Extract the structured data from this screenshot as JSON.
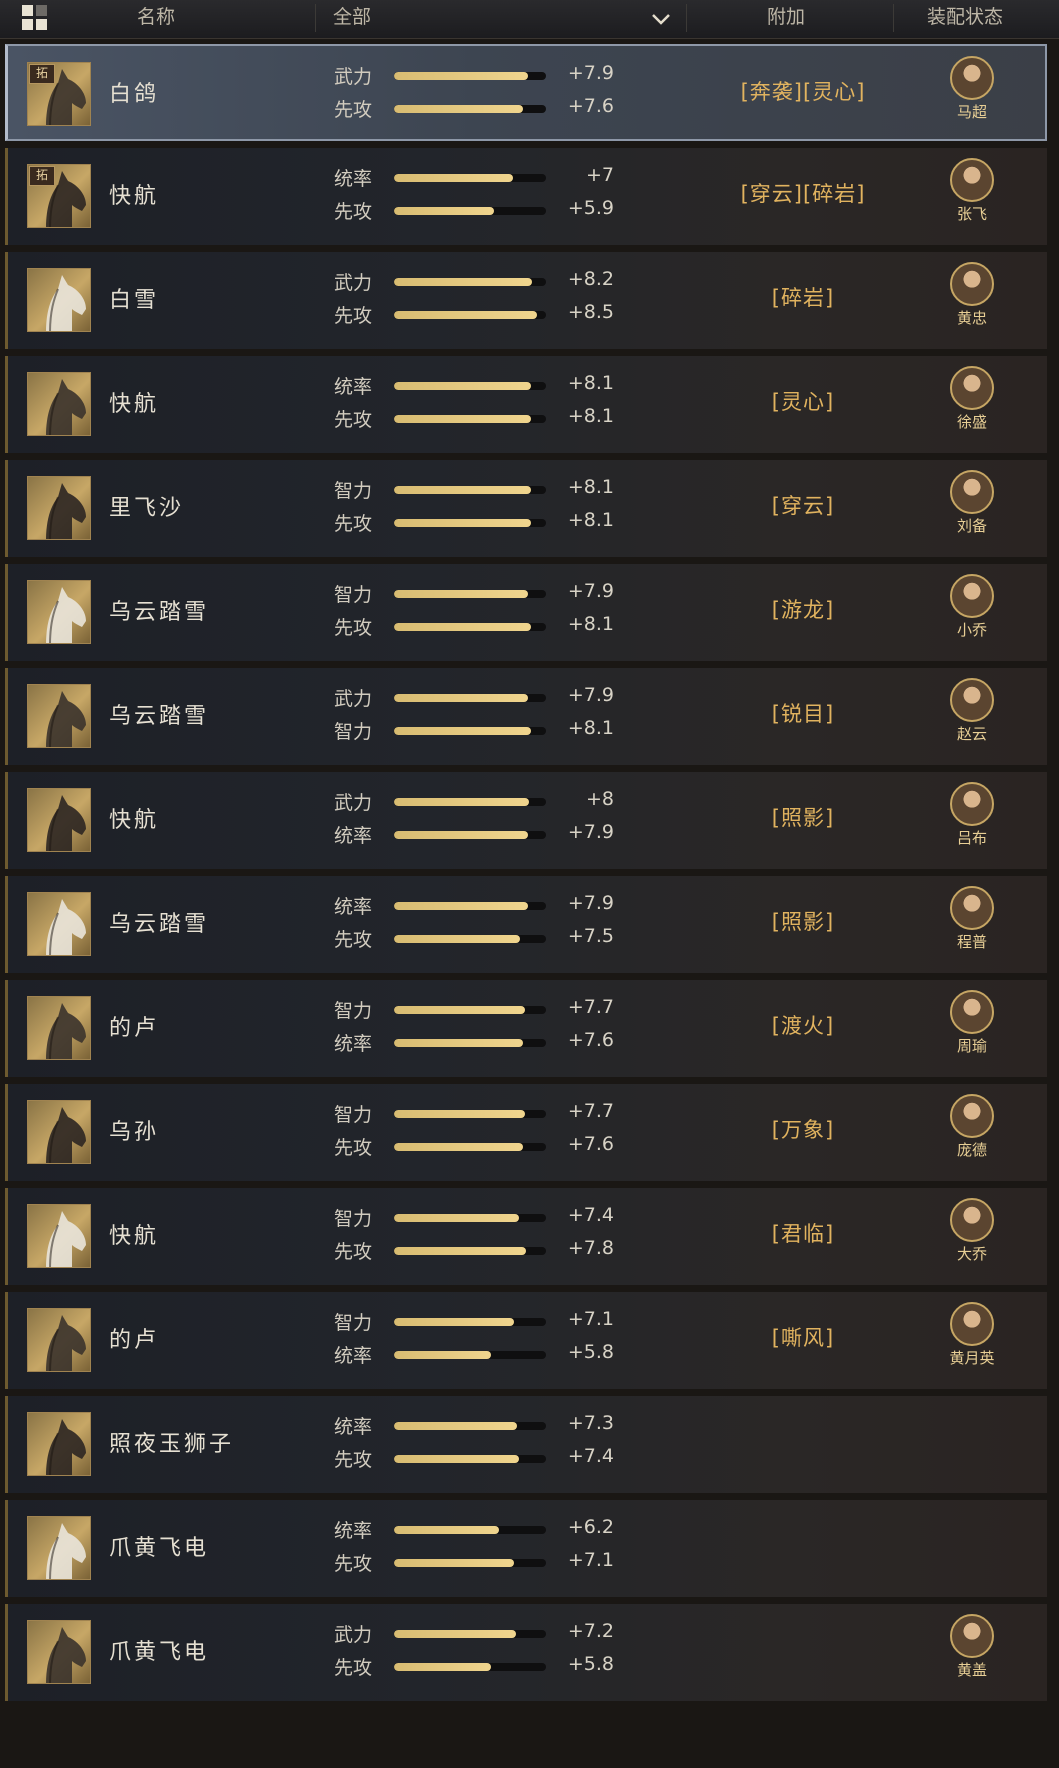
{
  "header": {
    "name_label": "名称",
    "filter_value": "全部",
    "extra_label": "附加",
    "equip_label": "装配状态"
  },
  "colors": {
    "accent_gold": "#e1b35f",
    "bar_fill": "#e8cc84",
    "selected_row": "#4a5464"
  },
  "rows": [
    {
      "tuo": "拓",
      "name": "白鸽",
      "s1": "武力",
      "p1": 0.88,
      "v1": "+7.9",
      "s2": "先攻",
      "p2": 0.85,
      "v2": "+7.6",
      "extra": "[奔袭][灵心]",
      "general": "马超",
      "selected": true
    },
    {
      "tuo": "拓",
      "name": "快航",
      "s1": "统率",
      "p1": 0.78,
      "v1": "+7",
      "s2": "先攻",
      "p2": 0.66,
      "v2": "+5.9",
      "extra": "[穿云][碎岩]",
      "general": "张飞",
      "selected": false
    },
    {
      "tuo": "",
      "name": "白雪",
      "s1": "武力",
      "p1": 0.91,
      "v1": "+8.2",
      "s2": "先攻",
      "p2": 0.94,
      "v2": "+8.5",
      "extra": "[碎岩]",
      "general": "黄忠",
      "selected": false
    },
    {
      "tuo": "",
      "name": "快航",
      "s1": "统率",
      "p1": 0.9,
      "v1": "+8.1",
      "s2": "先攻",
      "p2": 0.9,
      "v2": "+8.1",
      "extra": "[灵心]",
      "general": "徐盛",
      "selected": false
    },
    {
      "tuo": "",
      "name": "里飞沙",
      "s1": "智力",
      "p1": 0.9,
      "v1": "+8.1",
      "s2": "先攻",
      "p2": 0.9,
      "v2": "+8.1",
      "extra": "[穿云]",
      "general": "刘备",
      "selected": false
    },
    {
      "tuo": "",
      "name": "乌云踏雪",
      "s1": "智力",
      "p1": 0.88,
      "v1": "+7.9",
      "s2": "先攻",
      "p2": 0.9,
      "v2": "+8.1",
      "extra": "[游龙]",
      "general": "小乔",
      "selected": false
    },
    {
      "tuo": "",
      "name": "乌云踏雪",
      "s1": "武力",
      "p1": 0.88,
      "v1": "+7.9",
      "s2": "智力",
      "p2": 0.9,
      "v2": "+8.1",
      "extra": "[锐目]",
      "general": "赵云",
      "selected": false
    },
    {
      "tuo": "",
      "name": "快航",
      "s1": "武力",
      "p1": 0.89,
      "v1": "+8",
      "s2": "统率",
      "p2": 0.88,
      "v2": "+7.9",
      "extra": "[照影]",
      "general": "吕布",
      "selected": false
    },
    {
      "tuo": "",
      "name": "乌云踏雪",
      "s1": "统率",
      "p1": 0.88,
      "v1": "+7.9",
      "s2": "先攻",
      "p2": 0.83,
      "v2": "+7.5",
      "extra": "[照影]",
      "general": "程普",
      "selected": false
    },
    {
      "tuo": "",
      "name": "的卢",
      "s1": "智力",
      "p1": 0.86,
      "v1": "+7.7",
      "s2": "统率",
      "p2": 0.85,
      "v2": "+7.6",
      "extra": "[渡火]",
      "general": "周瑜",
      "selected": false
    },
    {
      "tuo": "",
      "name": "乌孙",
      "s1": "智力",
      "p1": 0.86,
      "v1": "+7.7",
      "s2": "先攻",
      "p2": 0.85,
      "v2": "+7.6",
      "extra": "[万象]",
      "general": "庞德",
      "selected": false
    },
    {
      "tuo": "",
      "name": "快航",
      "s1": "智力",
      "p1": 0.82,
      "v1": "+7.4",
      "s2": "先攻",
      "p2": 0.87,
      "v2": "+7.8",
      "extra": "[君临]",
      "general": "大乔",
      "selected": false
    },
    {
      "tuo": "",
      "name": "的卢",
      "s1": "智力",
      "p1": 0.79,
      "v1": "+7.1",
      "s2": "统率",
      "p2": 0.64,
      "v2": "+5.8",
      "extra": "[嘶风]",
      "general": "黄月英",
      "selected": false
    },
    {
      "tuo": "",
      "name": "照夜玉狮子",
      "s1": "统率",
      "p1": 0.81,
      "v1": "+7.3",
      "s2": "先攻",
      "p2": 0.82,
      "v2": "+7.4",
      "extra": "",
      "general": "",
      "selected": false
    },
    {
      "tuo": "",
      "name": "爪黄飞电",
      "s1": "统率",
      "p1": 0.69,
      "v1": "+6.2",
      "s2": "先攻",
      "p2": 0.79,
      "v2": "+7.1",
      "extra": "",
      "general": "",
      "selected": false
    },
    {
      "tuo": "",
      "name": "爪黄飞电",
      "s1": "武力",
      "p1": 0.8,
      "v1": "+7.2",
      "s2": "先攻",
      "p2": 0.64,
      "v2": "+5.8",
      "extra": "",
      "general": "黄盖",
      "selected": false
    }
  ]
}
